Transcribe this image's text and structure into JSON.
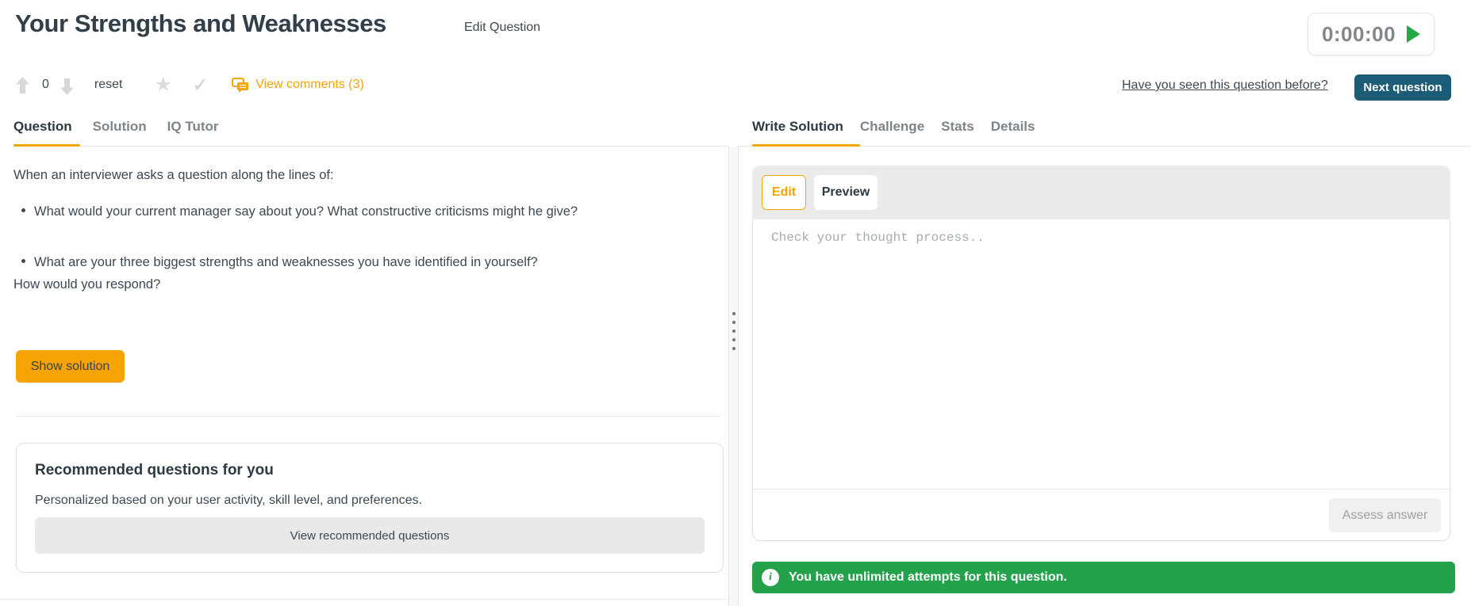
{
  "header": {
    "title": "Your Strengths and Weaknesses",
    "edit_question": "Edit Question",
    "timer": "0:00:00",
    "seen_before": "Have you seen this question before?",
    "next_question": "Next question"
  },
  "vote_bar": {
    "count": "0",
    "reset_label": "reset",
    "view_comments": "View comments (3)"
  },
  "left_tabs": [
    {
      "label": "Question",
      "active": true
    },
    {
      "label": "Solution",
      "active": false
    },
    {
      "label": "IQ Tutor",
      "active": false
    }
  ],
  "question": {
    "intro": "When an interviewer asks a question along the lines of:",
    "bullets": [
      "What would your current manager say about you? What constructive criticisms might he give?",
      "What are your three biggest strengths and weaknesses you have identified in yourself?"
    ],
    "outro": "How would you respond?",
    "show_solution": "Show solution"
  },
  "recommended": {
    "title": "Recommended questions for you",
    "subtitle": "Personalized based on your user activity, skill level, and preferences.",
    "button": "View recommended questions"
  },
  "right_tabs": [
    {
      "label": "Write Solution",
      "active": true
    },
    {
      "label": "Challenge",
      "active": false
    },
    {
      "label": "Stats",
      "active": false
    },
    {
      "label": "Details",
      "active": false
    }
  ],
  "editor": {
    "edit_label": "Edit",
    "preview_label": "Preview",
    "placeholder": "Check your thought process..",
    "assess_label": "Assess answer"
  },
  "banner": {
    "text": "You have unlimited attempts for this question."
  },
  "icons": {
    "upvote": "arrow-up",
    "downvote": "arrow-down",
    "favorite": "star",
    "mark_done": "check",
    "comments": "speech-bubbles",
    "timer_start": "play-triangle",
    "divider_handle": "vertical-dots",
    "banner_info": "info-circle"
  },
  "colors": {
    "accent_orange": "#F6A404",
    "teal_button": "#1D5C77",
    "success_green": "#23A24B",
    "play_green": "#28A745",
    "dark_text": "#333F48",
    "body_text": "#3C4852",
    "muted_text": "#7D848A",
    "muted_icon": "#D6D8DA",
    "toolbar_gray": "#EBEBE9",
    "border_gray": "#E0E0E0"
  }
}
